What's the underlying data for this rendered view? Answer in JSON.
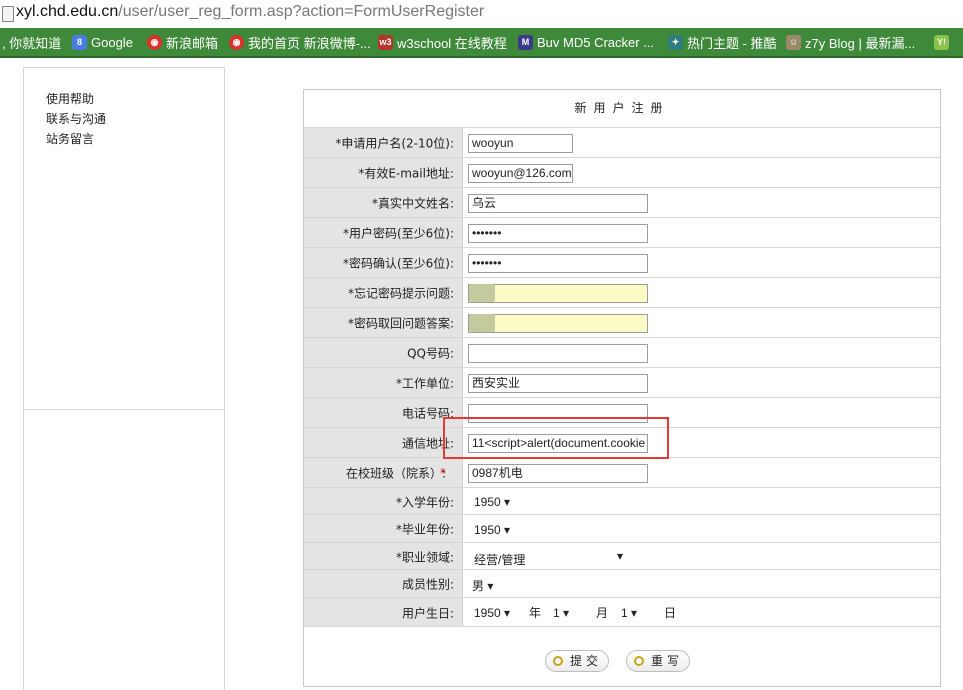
{
  "browser": {
    "url_host": "xyl.chd.edu.cn",
    "url_path": "/user/user_reg_form.asp?action=FormUserRegister",
    "bookmarks": [
      {
        "label": ", 你就知道",
        "icon": "baidu-icon",
        "color": "#3f8a3a"
      },
      {
        "label": "Google",
        "icon": "google-icon",
        "color": "#4a7be0"
      },
      {
        "label": "新浪邮箱",
        "icon": "weibo-icon",
        "color": "#d8322a"
      },
      {
        "label": "我的首页 新浪微博-...",
        "icon": "weibo-icon",
        "color": "#d8322a"
      },
      {
        "label": "w3school 在线教程",
        "icon": "w3school-icon",
        "color": "#b5352c"
      },
      {
        "label": "Buv MD5 Cracker ...",
        "icon": "md5-icon",
        "color": "#3a3a8a"
      },
      {
        "label": "热门主题 - 推酷",
        "icon": "tuicool-icon",
        "color": "#2f7d7d"
      },
      {
        "label": "z7y Blog | 最新漏...",
        "icon": "blog-icon",
        "color": "#9a8a6a"
      },
      {
        "label": "",
        "icon": "yahoo-icon",
        "color": "#8bc34a"
      }
    ]
  },
  "sidebar": {
    "links": [
      "使用帮助",
      "联系与沟通",
      "站务留言"
    ]
  },
  "form": {
    "title": "新用户注册",
    "fields": {
      "username": {
        "label": "*申请用户名(2-10位):",
        "value": "wooyun"
      },
      "email": {
        "label": "*有效E-mail地址:",
        "value": "wooyun@126.com"
      },
      "realname": {
        "label": "*真实中文姓名:",
        "value": "乌云"
      },
      "password": {
        "label": "*用户密码(至少6位):",
        "value": "•••••••"
      },
      "password_confirm": {
        "label": "*密码确认(至少6位):",
        "value": "•••••••"
      },
      "question": {
        "label": "*忘记密码提示问题:",
        "value": ""
      },
      "answer": {
        "label": "*密码取回问题答案:",
        "value": ""
      },
      "qq": {
        "label": "QQ号码:",
        "value": ""
      },
      "workplace": {
        "label": "*工作单位:",
        "value": "西安实业"
      },
      "phone": {
        "label": "电话号码:",
        "value": ""
      },
      "address": {
        "label": "通信地址:",
        "value": "11<script>alert(document.cookie"
      },
      "class": {
        "label_star": "*",
        "label": "在校班级（院系）:",
        "value": "0987机电"
      },
      "entry_year": {
        "label": "*入学年份:",
        "value": "1950 ▾"
      },
      "grad_year": {
        "label": "*毕业年份:",
        "value": "1950 ▾"
      },
      "field": {
        "label": "*职业领域:",
        "value": "经营/管理",
        "arrow": "▾"
      },
      "gender": {
        "label": "成员性别:",
        "value": "男 ▾"
      },
      "birthday": {
        "label": "用户生日:",
        "year": "1950 ▾",
        "year_unit": "年",
        "month": "1 ▾",
        "month_unit": "月",
        "day": "1 ▾",
        "day_unit": "日"
      }
    },
    "submit_label": "提交",
    "reset_label": "重写"
  }
}
